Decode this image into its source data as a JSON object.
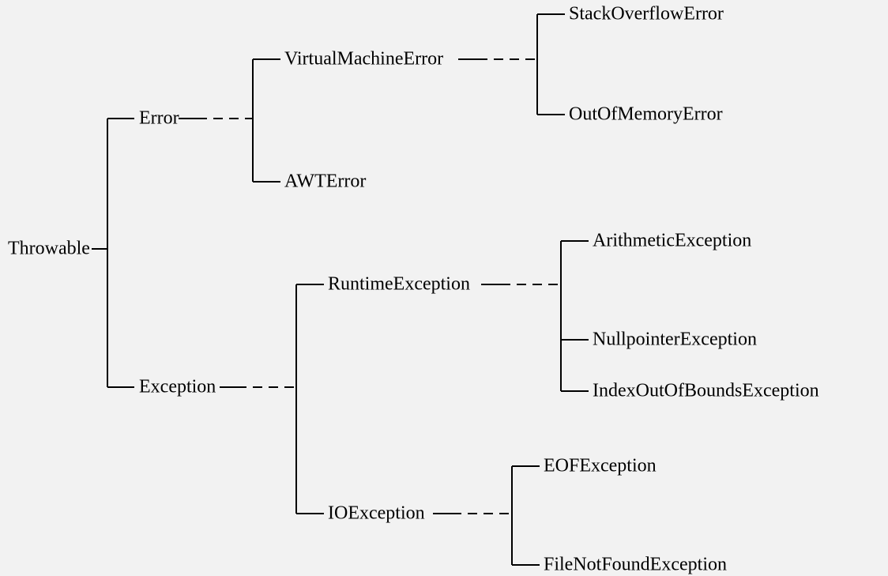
{
  "root": "Throwable",
  "error": "Error",
  "vmerror": "VirtualMachineError",
  "awterror": "AWTError",
  "stackoverflow": "StackOverflowError",
  "oom": "OutOfMemoryError",
  "exception": "Exception",
  "runtime": "RuntimeException",
  "ioexception": "IOException",
  "arithmetic": "ArithmeticException",
  "nullpointer": "NullpointerException",
  "indexoob": "IndexOutOfBoundsException",
  "eof": "EOFException",
  "fnf": "FileNotFoundException"
}
